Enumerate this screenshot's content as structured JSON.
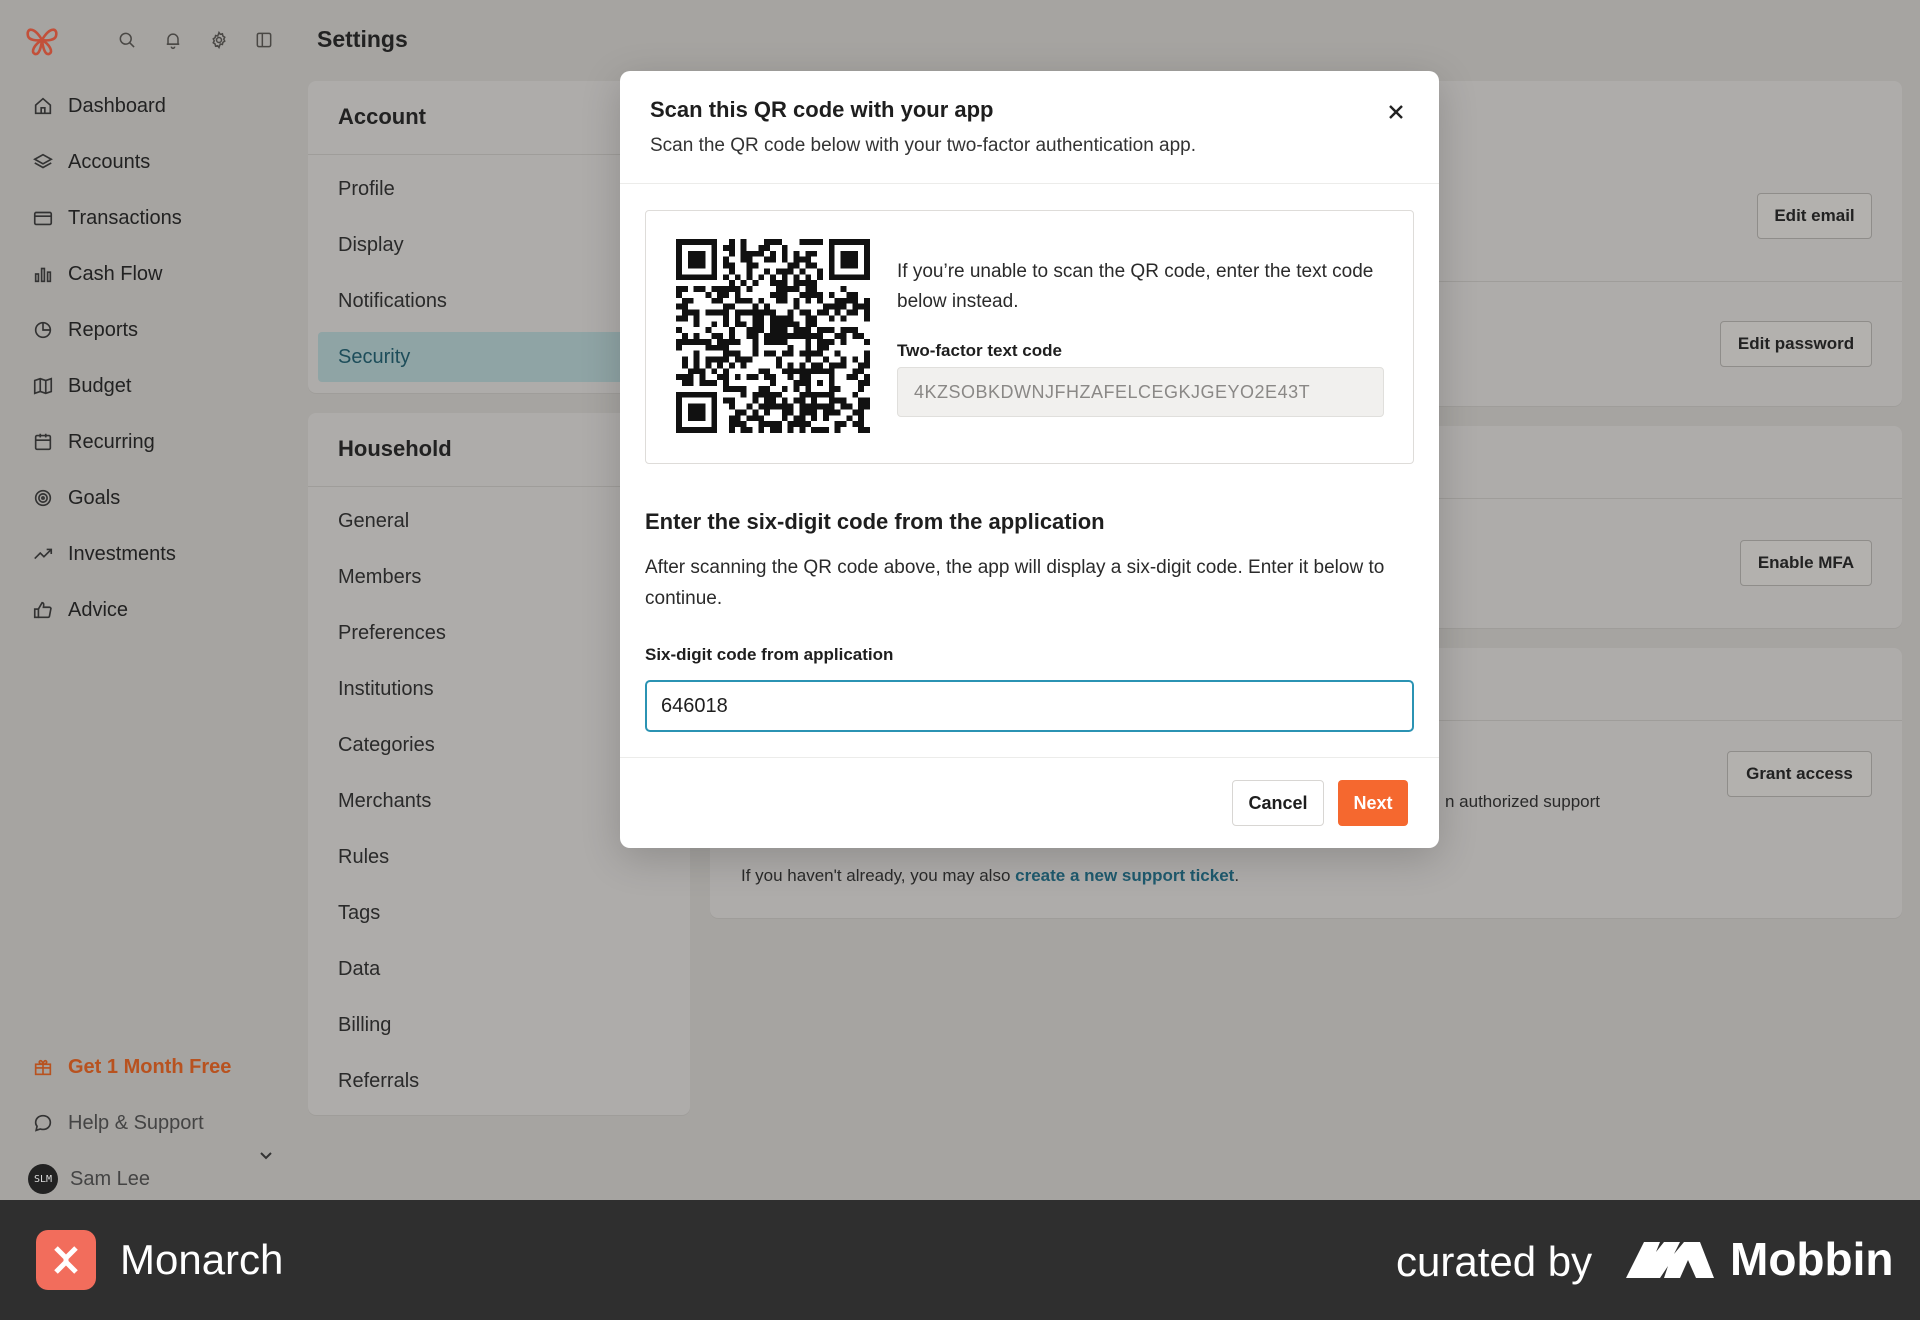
{
  "app": {
    "page_title": "Settings",
    "sidebar": {
      "items": [
        {
          "label": "Dashboard",
          "icon": "home-icon"
        },
        {
          "label": "Accounts",
          "icon": "layers-icon"
        },
        {
          "label": "Transactions",
          "icon": "card-icon"
        },
        {
          "label": "Cash Flow",
          "icon": "bar-chart-icon"
        },
        {
          "label": "Reports",
          "icon": "pie-icon"
        },
        {
          "label": "Budget",
          "icon": "map-icon"
        },
        {
          "label": "Recurring",
          "icon": "calendar-icon"
        },
        {
          "label": "Goals",
          "icon": "target-icon"
        },
        {
          "label": "Investments",
          "icon": "trend-up-icon"
        },
        {
          "label": "Advice",
          "icon": "thumbs-up-icon"
        }
      ],
      "promo": "Get 1 Month Free",
      "help": "Help & Support",
      "user": {
        "name": "Sam Lee",
        "initials": "SLM"
      }
    },
    "account_section": {
      "title": "Account",
      "items": [
        "Profile",
        "Display",
        "Notifications",
        "Security"
      ],
      "active": "Security"
    },
    "household_section": {
      "title": "Household",
      "items": [
        "General",
        "Members",
        "Preferences",
        "Institutions",
        "Categories",
        "Merchants",
        "Rules",
        "Tags",
        "Data",
        "Billing",
        "Referrals"
      ]
    },
    "security_panel": {
      "edit_email": "Edit email",
      "edit_password": "Edit password",
      "enable_mfa": "Enable MFA",
      "grant_access": "Grant access",
      "support_fragment": "n authorized support",
      "ticket_prefix": "If you haven't already, you may also ",
      "ticket_link": "create a new support ticket",
      "ticket_suffix": "."
    }
  },
  "modal": {
    "title": "Scan this QR code with your app",
    "subtitle": "Scan the QR code below with your two-factor authentication app.",
    "qr_help": "If you’re unable to scan the QR code, enter the text code below instead.",
    "text_code_label": "Two-factor text code",
    "text_code": "4KZSOBKDWNJFHZAFELCEGKJGEYO2E43T",
    "section_heading": "Enter the six-digit code from the application",
    "section_body": "After scanning the QR code above, the app will display a six-digit code. Enter it below to continue.",
    "code_label": "Six-digit code from application",
    "code_value": "646018",
    "cancel": "Cancel",
    "next": "Next",
    "accent_color": "#f5682f",
    "focus_color": "#2b93b3"
  },
  "footer": {
    "brand": "Monarch",
    "curated_by": "curated by",
    "curator": "Mobbin"
  }
}
